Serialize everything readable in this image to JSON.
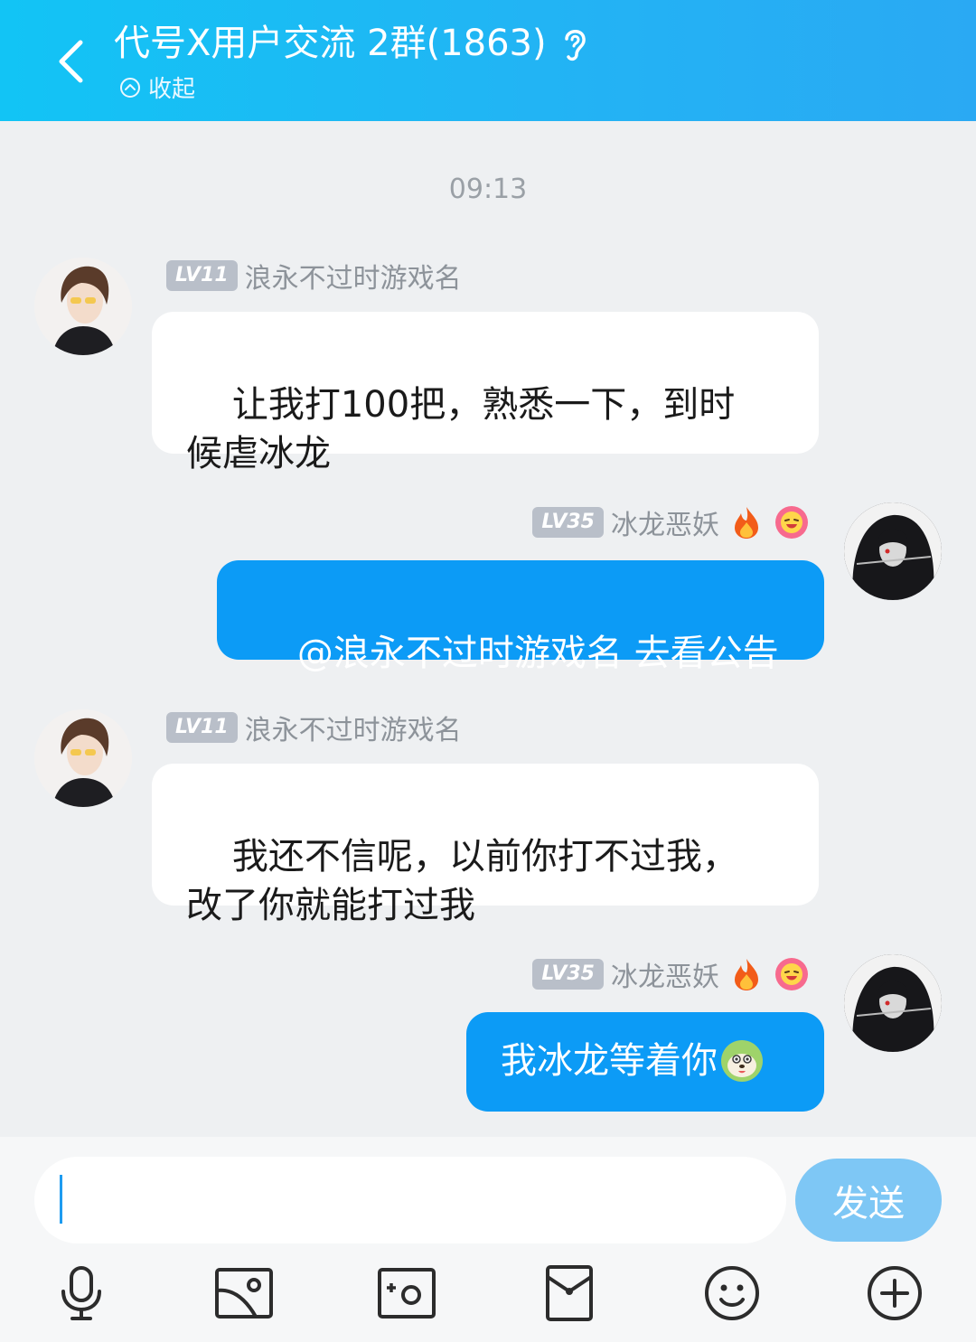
{
  "header": {
    "title": "代号X用户交流 2群(1863)",
    "collapse_label": "收起",
    "background": "#1ab8f4"
  },
  "timestamp": "09:13",
  "messages": [
    {
      "side": "left",
      "level": "LV11",
      "nickname": "浪永不过时游戏名",
      "text": "让我打100把，熟悉一下，到时\n候虐冰龙"
    },
    {
      "side": "right",
      "level": "LV35",
      "nickname": "冰龙恶妖",
      "text": "@浪永不过时游戏名 去看公告"
    },
    {
      "side": "left",
      "level": "LV11",
      "nickname": "浪永不过时游戏名",
      "text": "我还不信呢，以前你打不过我，\n改了你就能打过我"
    },
    {
      "side": "right",
      "level": "LV35",
      "nickname": "冰龙恶妖",
      "text": "我冰龙等着你"
    }
  ],
  "input": {
    "value": "",
    "send_label": "发送"
  },
  "toolbar": [
    "mic-icon",
    "image-icon",
    "camera-icon",
    "red-packet-icon",
    "emoji-icon",
    "plus-icon"
  ],
  "colors": {
    "outgoing_bubble": "#0c9bf6",
    "incoming_bubble": "#ffffff",
    "send_button": "#7ec7f5",
    "chat_background": "#eef0f2"
  }
}
